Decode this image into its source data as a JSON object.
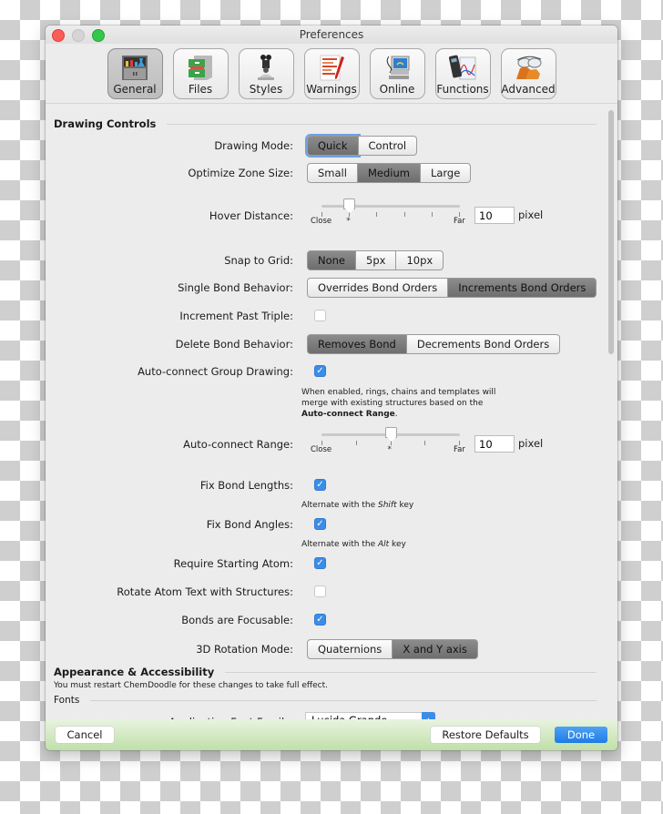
{
  "window": {
    "title": "Preferences"
  },
  "toolbar": {
    "tabs": [
      {
        "label": "General",
        "icon": "lab-cabinet-icon",
        "active": true
      },
      {
        "label": "Files",
        "icon": "file-cabinet-icon",
        "active": false
      },
      {
        "label": "Styles",
        "icon": "microscope-icon",
        "active": false
      },
      {
        "label": "Warnings",
        "icon": "warning-document-icon",
        "active": false
      },
      {
        "label": "Online",
        "icon": "computer-icon",
        "active": false
      },
      {
        "label": "Functions",
        "icon": "calculator-graph-icon",
        "active": false
      },
      {
        "label": "Advanced",
        "icon": "goggles-gloves-icon",
        "active": false
      }
    ]
  },
  "drawing_controls": {
    "heading": "Drawing Controls",
    "drawing_mode": {
      "label": "Drawing Mode:",
      "options": [
        "Quick",
        "Control"
      ],
      "selected": "Quick"
    },
    "optimize_zone_size": {
      "label": "Optimize Zone Size:",
      "options": [
        "Small",
        "Medium",
        "Large"
      ],
      "selected": "Medium"
    },
    "hover_distance": {
      "label": "Hover Distance:",
      "min_label": "Close",
      "max_label": "Far",
      "default_marker": "*",
      "ticks": 6,
      "position": 1,
      "value": "10",
      "unit": "pixel"
    },
    "snap_to_grid": {
      "label": "Snap to Grid:",
      "options": [
        "None",
        "5px",
        "10px"
      ],
      "selected": "None"
    },
    "single_bond_behavior": {
      "label": "Single Bond Behavior:",
      "options": [
        "Overrides Bond Orders",
        "Increments Bond Orders"
      ],
      "selected": "Increments Bond Orders"
    },
    "increment_past_triple": {
      "label": "Increment Past Triple:",
      "checked": false
    },
    "delete_bond_behavior": {
      "label": "Delete Bond Behavior:",
      "options": [
        "Removes Bond",
        "Decrements Bond Orders"
      ],
      "selected": "Removes Bond"
    },
    "auto_connect_group": {
      "label": "Auto-connect Group Drawing:",
      "checked": true,
      "hint_line1": "When enabled, rings, chains and templates will",
      "hint_line2": "merge with existing structures based on the",
      "hint_bold": "Auto-connect Range",
      "hint_end": "."
    },
    "auto_connect_range": {
      "label": "Auto-connect Range:",
      "min_label": "Close",
      "max_label": "Far",
      "default_marker": "*",
      "ticks": 5,
      "position": 2,
      "value": "10",
      "unit": "pixel"
    },
    "fix_bond_lengths": {
      "label": "Fix Bond Lengths:",
      "checked": true,
      "hint_pre": "Alternate with the ",
      "hint_key": "Shift",
      "hint_post": " key"
    },
    "fix_bond_angles": {
      "label": "Fix Bond Angles:",
      "checked": true,
      "hint_pre": "Alternate with the ",
      "hint_key": "Alt",
      "hint_post": " key"
    },
    "require_starting_atom": {
      "label": "Require Starting Atom:",
      "checked": true
    },
    "rotate_atom_text": {
      "label": "Rotate Atom Text with Structures:",
      "checked": false
    },
    "bonds_focusable": {
      "label": "Bonds are Focusable:",
      "checked": true
    },
    "rotation_mode_3d": {
      "label": "3D Rotation Mode:",
      "options": [
        "Quaternions",
        "X and Y axis"
      ],
      "selected": "X and Y axis"
    }
  },
  "appearance": {
    "heading": "Appearance & Accessibility",
    "note": "You must restart ChemDoodle for these changes to take full effect.",
    "fonts_heading": "Fonts",
    "app_font_family": {
      "label": "Application Font Family:",
      "value": "Lucida Grande"
    }
  },
  "footer": {
    "cancel": "Cancel",
    "restore_defaults": "Restore Defaults",
    "done": "Done"
  }
}
